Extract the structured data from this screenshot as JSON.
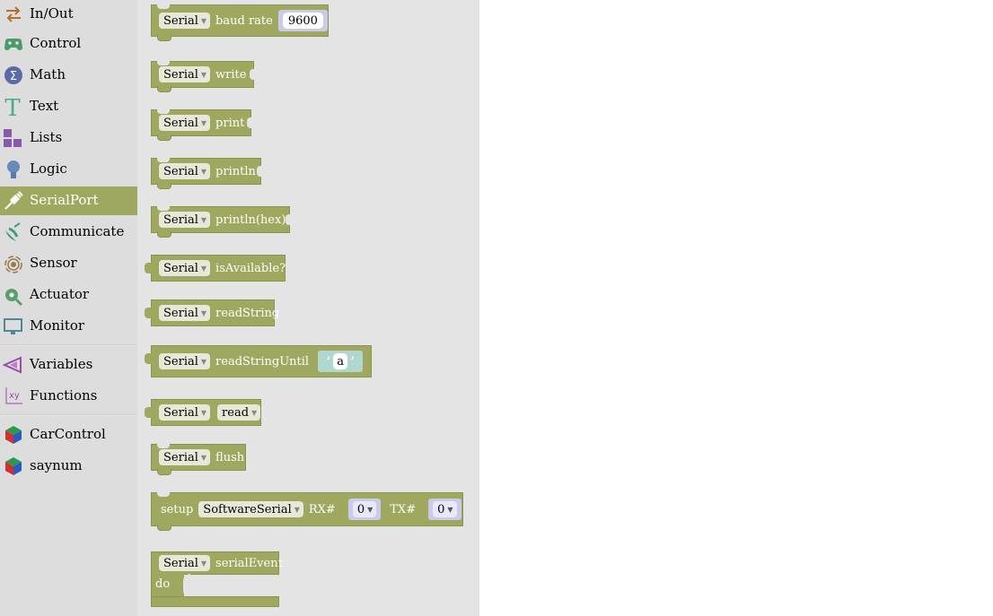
{
  "sidebar": {
    "items": [
      {
        "label": "In/Out",
        "icon": "in-out-icon"
      },
      {
        "label": "Control",
        "icon": "gamepad-icon"
      },
      {
        "label": "Math",
        "icon": "math-icon"
      },
      {
        "label": "Text",
        "icon": "text-icon"
      },
      {
        "label": "Lists",
        "icon": "lists-icon"
      },
      {
        "label": "Logic",
        "icon": "lightbulb-icon"
      },
      {
        "label": "SerialPort",
        "icon": "usb-plug-icon",
        "selected": true
      },
      {
        "label": "Communicate",
        "icon": "satellite-dish-icon"
      },
      {
        "label": "Sensor",
        "icon": "sensor-icon"
      },
      {
        "label": "Actuator",
        "icon": "actuator-icon"
      },
      {
        "label": "Monitor",
        "icon": "monitor-icon"
      },
      {
        "label": "Variables",
        "icon": "variables-icon"
      },
      {
        "label": "Functions",
        "icon": "functions-icon"
      },
      {
        "label": "CarControl",
        "icon": "cube-icon"
      },
      {
        "label": "saynum",
        "icon": "cube-icon"
      }
    ],
    "selected_color": "#a0a860"
  },
  "blocks": {
    "serial_dropdown": "Serial",
    "baud_rate": {
      "label": "baud rate",
      "value": "9600"
    },
    "write": {
      "label": "write"
    },
    "print": {
      "label": "print"
    },
    "println": {
      "label": "println"
    },
    "println_hex": {
      "label": "println(hex)"
    },
    "is_available": {
      "label": "isAvailable?"
    },
    "read_string": {
      "label": "readString"
    },
    "read_string_until": {
      "label": "readStringUntil",
      "char": "a",
      "open_quote": "‘",
      "close_quote": "’"
    },
    "read": {
      "mode": "read"
    },
    "flush": {
      "label": "flush"
    },
    "setup": {
      "label": "setup",
      "type": "SoftwareSerial",
      "rx_label": "RX#",
      "rx_value": "0",
      "tx_label": "TX#",
      "tx_value": "0"
    },
    "serial_event": {
      "label": "serialEvent",
      "do_label": "do"
    }
  },
  "colors": {
    "block": "#a0a860",
    "flyout_bg": "#e4e4e4",
    "sidebar_bg": "#dddddd"
  }
}
